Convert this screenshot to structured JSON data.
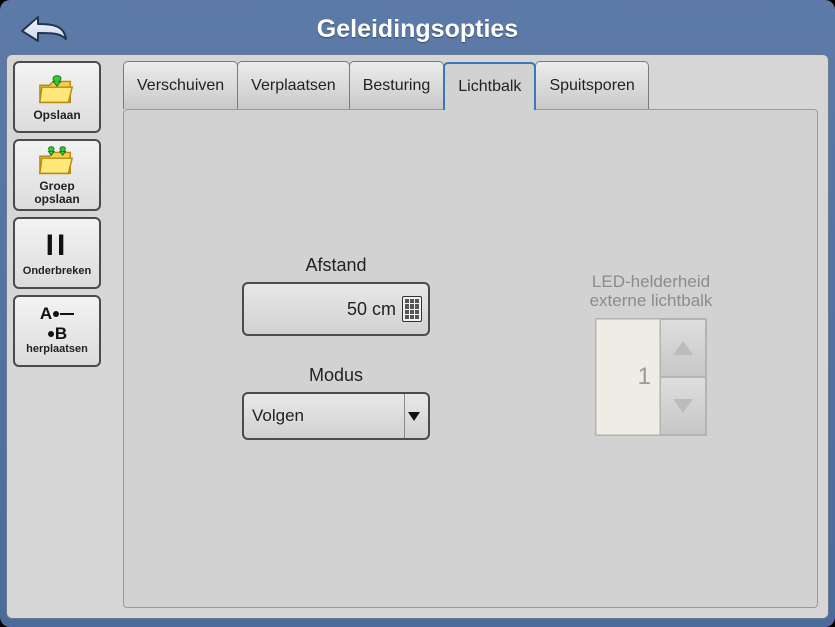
{
  "header": {
    "title": "Geleidingsopties"
  },
  "sidebar": {
    "items": [
      {
        "label": "Opslaan"
      },
      {
        "label": "Groep opslaan"
      },
      {
        "label": "Onderbreken"
      },
      {
        "label": "herplaatsen"
      }
    ]
  },
  "tabs": {
    "items": [
      {
        "label": "Verschuiven",
        "active": false
      },
      {
        "label": "Verplaatsen",
        "active": false
      },
      {
        "label": "Besturing",
        "active": false
      },
      {
        "label": "Lichtbalk",
        "active": true
      },
      {
        "label": "Spuitsporen",
        "active": false
      }
    ]
  },
  "lichtbalk": {
    "afstand": {
      "label": "Afstand",
      "value": "50 cm"
    },
    "modus": {
      "label": "Modus",
      "selected": "Volgen"
    },
    "led": {
      "label_line1": "LED-helderheid",
      "label_line2": "externe lichtbalk",
      "value": "1"
    }
  }
}
